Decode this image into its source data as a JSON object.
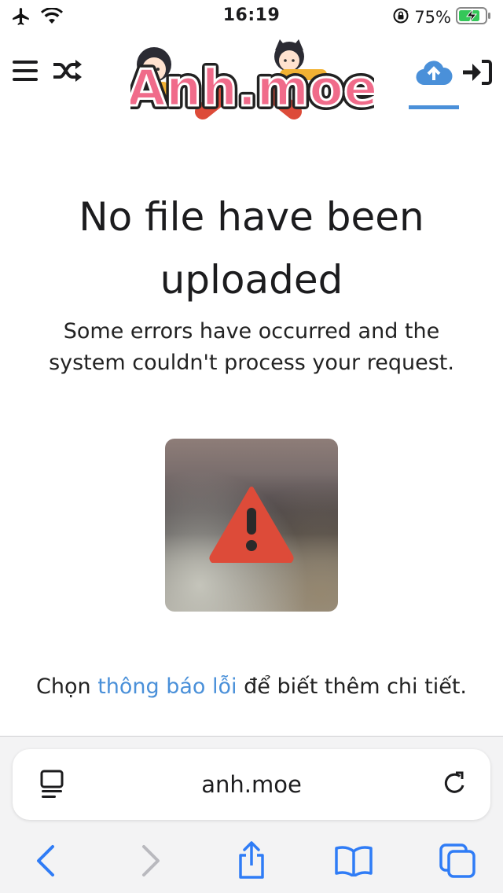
{
  "status_bar": {
    "time": "16:19",
    "battery_percent": "75%",
    "icons": [
      "airplane-icon",
      "wifi-icon",
      "orientation-lock-icon",
      "battery-charging-icon"
    ]
  },
  "header": {
    "logo_text": "Anh.moe",
    "buttons": [
      "menu-icon",
      "shuffle-icon",
      "upload-cloud-icon",
      "sign-in-icon"
    ],
    "accent_color": "#4a90d9"
  },
  "main": {
    "title": "No file have been uploaded",
    "description": "Some errors have occurred and the system couldn't process your request.",
    "warning_icon": "warning-triangle-icon",
    "warning_color": "#dd4b39",
    "help_prefix": "Chọn ",
    "help_link": "thông báo lỗi",
    "help_suffix": " để biết thêm chi tiết."
  },
  "browser": {
    "url": "anh.moe",
    "nav_icons": [
      "back-icon",
      "forward-icon",
      "share-icon",
      "bookmarks-icon",
      "tabs-icon"
    ],
    "link_color": "#2f7cf6"
  }
}
